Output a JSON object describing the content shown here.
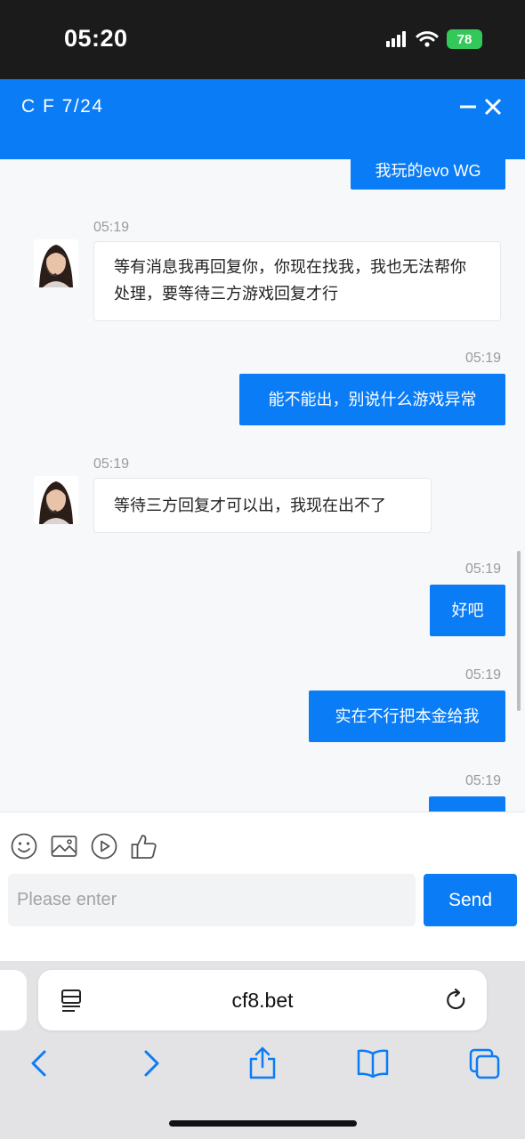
{
  "status_bar": {
    "time": "05:20",
    "battery": "78"
  },
  "chat_header": {
    "title": "C F 7/24",
    "minimize_icon": "minus-icon",
    "close_icon": "close-icon"
  },
  "messages": [
    {
      "from": "user",
      "time": "",
      "text": "我玩的evo WG"
    },
    {
      "from": "agent",
      "time": "05:19",
      "text": "等有消息我再回复你，你现在找我，我也无法帮你处理，要等待三方游戏回复才行"
    },
    {
      "from": "user",
      "time": "05:19",
      "text": "能不能出，别说什么游戏异常"
    },
    {
      "from": "agent",
      "time": "05:19",
      "text": "等待三方回复才可以出，我现在出不了"
    },
    {
      "from": "user",
      "time": "05:19",
      "text": "好吧"
    },
    {
      "from": "user",
      "time": "05:19",
      "text": "实在不行把本金给我"
    },
    {
      "from": "user",
      "time": "05:19",
      "text": ""
    }
  ],
  "composer": {
    "tools": [
      "emoji-icon",
      "image-icon",
      "video-icon",
      "thumbs-up-icon"
    ],
    "placeholder": "Please enter",
    "send_label": "Send"
  },
  "browser": {
    "url": "cf8.bet",
    "nav_icons": [
      "back-icon",
      "forward-icon",
      "share-icon",
      "bookmarks-icon",
      "tabs-icon"
    ]
  },
  "colors": {
    "accent": "#0a7cf5",
    "status_bar_bg": "#1b1b1b",
    "battery": "#34c759",
    "chat_bg": "#f7f8fa"
  }
}
